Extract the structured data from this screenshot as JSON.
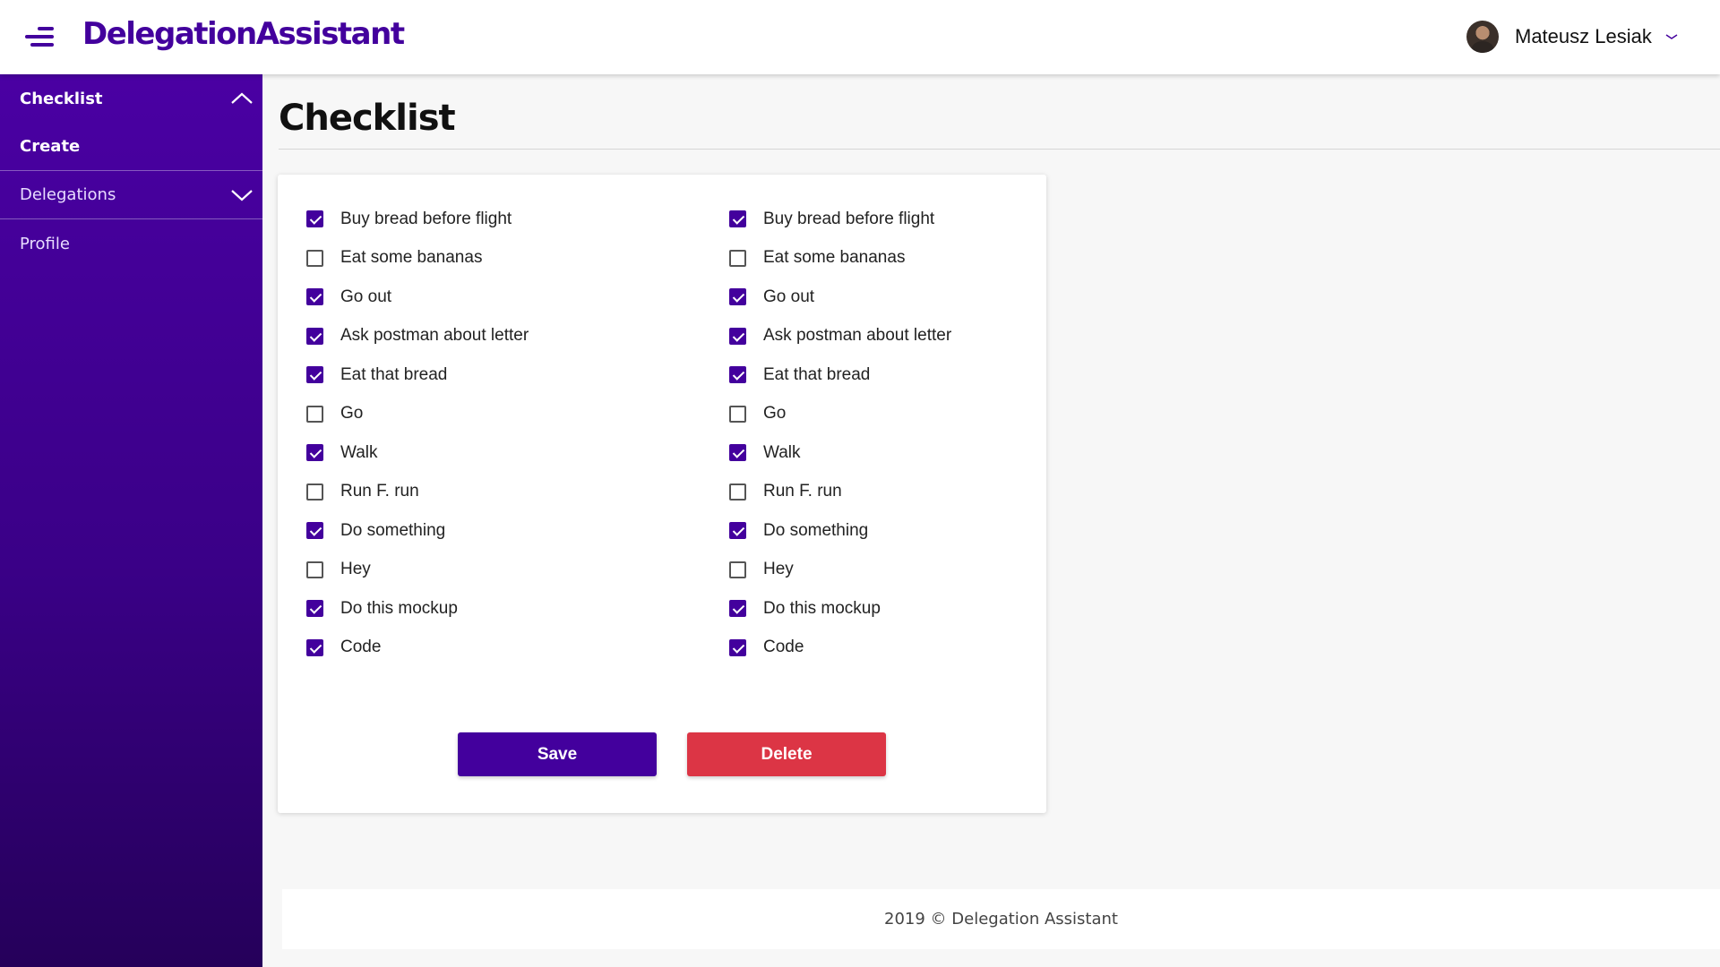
{
  "header": {
    "brand": "DelegationAssistant",
    "user_name": "Mateusz Lesiak"
  },
  "sidebar": {
    "items": [
      {
        "label": "Checklist",
        "expanded": true
      },
      {
        "label": "Create"
      },
      {
        "label": "Delegations",
        "expanded": false
      },
      {
        "label": "Profile"
      }
    ]
  },
  "main": {
    "title": "Checklist",
    "checklists": [
      {
        "items": [
          {
            "label": "Buy bread before flight",
            "checked": true
          },
          {
            "label": "Eat some bananas",
            "checked": false
          },
          {
            "label": "Go out",
            "checked": true
          },
          {
            "label": "Ask postman about letter",
            "checked": true
          },
          {
            "label": "Eat that bread",
            "checked": true
          },
          {
            "label": "Go",
            "checked": false
          },
          {
            "label": "Walk",
            "checked": true
          },
          {
            "label": "Run F. run",
            "checked": false
          },
          {
            "label": "Do something",
            "checked": true
          },
          {
            "label": "Hey",
            "checked": false
          },
          {
            "label": "Do this mockup",
            "checked": true
          },
          {
            "label": "Code",
            "checked": true
          }
        ]
      },
      {
        "items": [
          {
            "label": "Buy bread before flight",
            "checked": true
          },
          {
            "label": "Eat some bananas",
            "checked": false
          },
          {
            "label": "Go out",
            "checked": true
          },
          {
            "label": "Ask postman about letter",
            "checked": true
          },
          {
            "label": "Eat that bread",
            "checked": true
          },
          {
            "label": "Go",
            "checked": false
          },
          {
            "label": "Walk",
            "checked": true
          },
          {
            "label": "Run F. run",
            "checked": false
          },
          {
            "label": "Do something",
            "checked": true
          },
          {
            "label": "Hey",
            "checked": false
          },
          {
            "label": "Do this mockup",
            "checked": true
          },
          {
            "label": "Code",
            "checked": true
          }
        ]
      }
    ],
    "save_label": "Save",
    "delete_label": "Delete"
  },
  "footer": {
    "text": "2019 © Delegation Assistant"
  },
  "colors": {
    "brand": "#43009d",
    "danger": "#dc3545"
  },
  "icons": [
    "hamburger-menu-icon",
    "avatar",
    "chevron-down-icon",
    "chevron-up-icon",
    "checkbox-icon"
  ]
}
